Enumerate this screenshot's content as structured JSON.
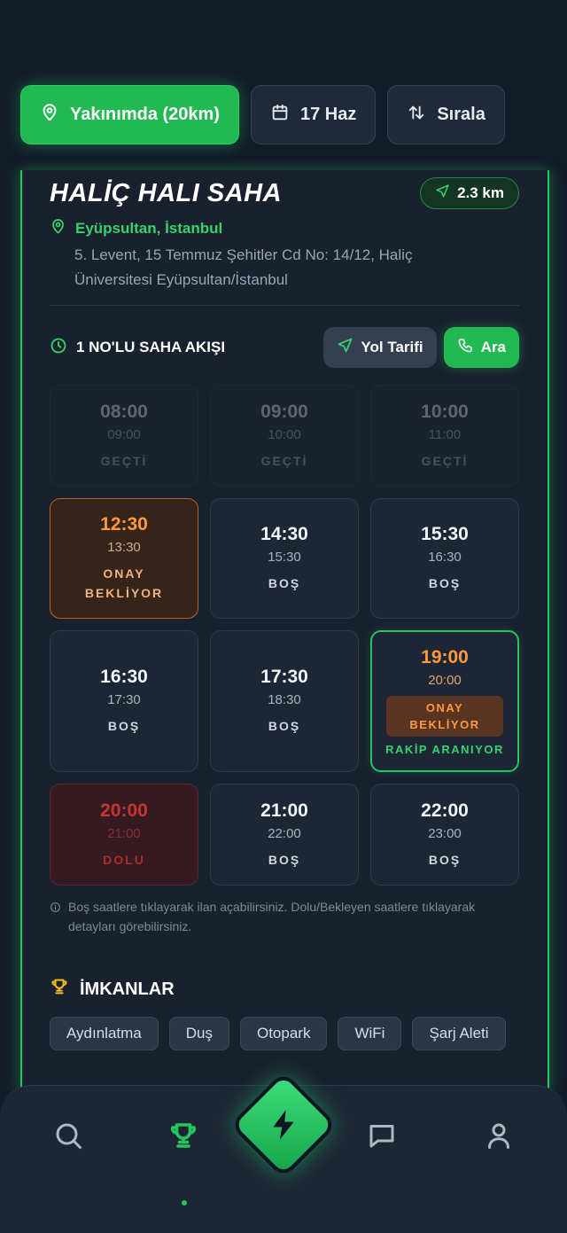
{
  "filters": {
    "nearby_label": "Yakınımda (20km)",
    "date_label": "17 Haz",
    "sort_label": "Sırala"
  },
  "venue": {
    "name": "HALİÇ HALI SAHA",
    "distance": "2.3 km",
    "city": "Eyüpsultan, İstanbul",
    "address": "5. Levent, 15 Temmuz Şehitler Cd No: 14/12, Haliç Üniversitesi Eyüpsultan/İstanbul"
  },
  "schedule": {
    "title": "1 NO'LU SAHA AKIŞI",
    "route_label": "Yol Tarifi",
    "call_label": "Ara",
    "slots": [
      {
        "start": "08:00",
        "end": "09:00",
        "status": "GEÇTİ"
      },
      {
        "start": "09:00",
        "end": "10:00",
        "status": "GEÇTİ"
      },
      {
        "start": "10:00",
        "end": "11:00",
        "status": "GEÇTİ"
      },
      {
        "start": "12:30",
        "end": "13:30",
        "status_line1": "ONAY",
        "status_line2": "BEKLİYOR"
      },
      {
        "start": "14:30",
        "end": "15:30",
        "status": "BOŞ"
      },
      {
        "start": "15:30",
        "end": "16:30",
        "status": "BOŞ"
      },
      {
        "start": "16:30",
        "end": "17:30",
        "status": "BOŞ"
      },
      {
        "start": "17:30",
        "end": "18:30",
        "status": "BOŞ"
      },
      {
        "start": "19:00",
        "end": "20:00",
        "badge_line1": "ONAY",
        "badge_line2": "BEKLİYOR",
        "status": "RAKİP ARANIYOR"
      },
      {
        "start": "20:00",
        "end": "21:00",
        "status": "DOLU"
      },
      {
        "start": "21:00",
        "end": "22:00",
        "status": "BOŞ"
      },
      {
        "start": "22:00",
        "end": "23:00",
        "status": "BOŞ"
      }
    ],
    "hint": "Boş saatlere tıklayarak ilan açabilirsiniz. Dolu/Bekleyen saatlere tıklayarak detayları görebilirsiniz."
  },
  "amenities": {
    "title": "İMKANLAR",
    "items": [
      "Aydınlatma",
      "Duş",
      "Otopark",
      "WiFi",
      "Şarj Aleti"
    ]
  },
  "colors": {
    "accent": "#22c55e",
    "pending": "#ff9a3c",
    "full": "#e53935"
  },
  "nav": {
    "icons": [
      "search-icon",
      "trophy-icon",
      "lightning-icon",
      "chat-icon",
      "user-icon"
    ],
    "active": "trophy-icon"
  }
}
